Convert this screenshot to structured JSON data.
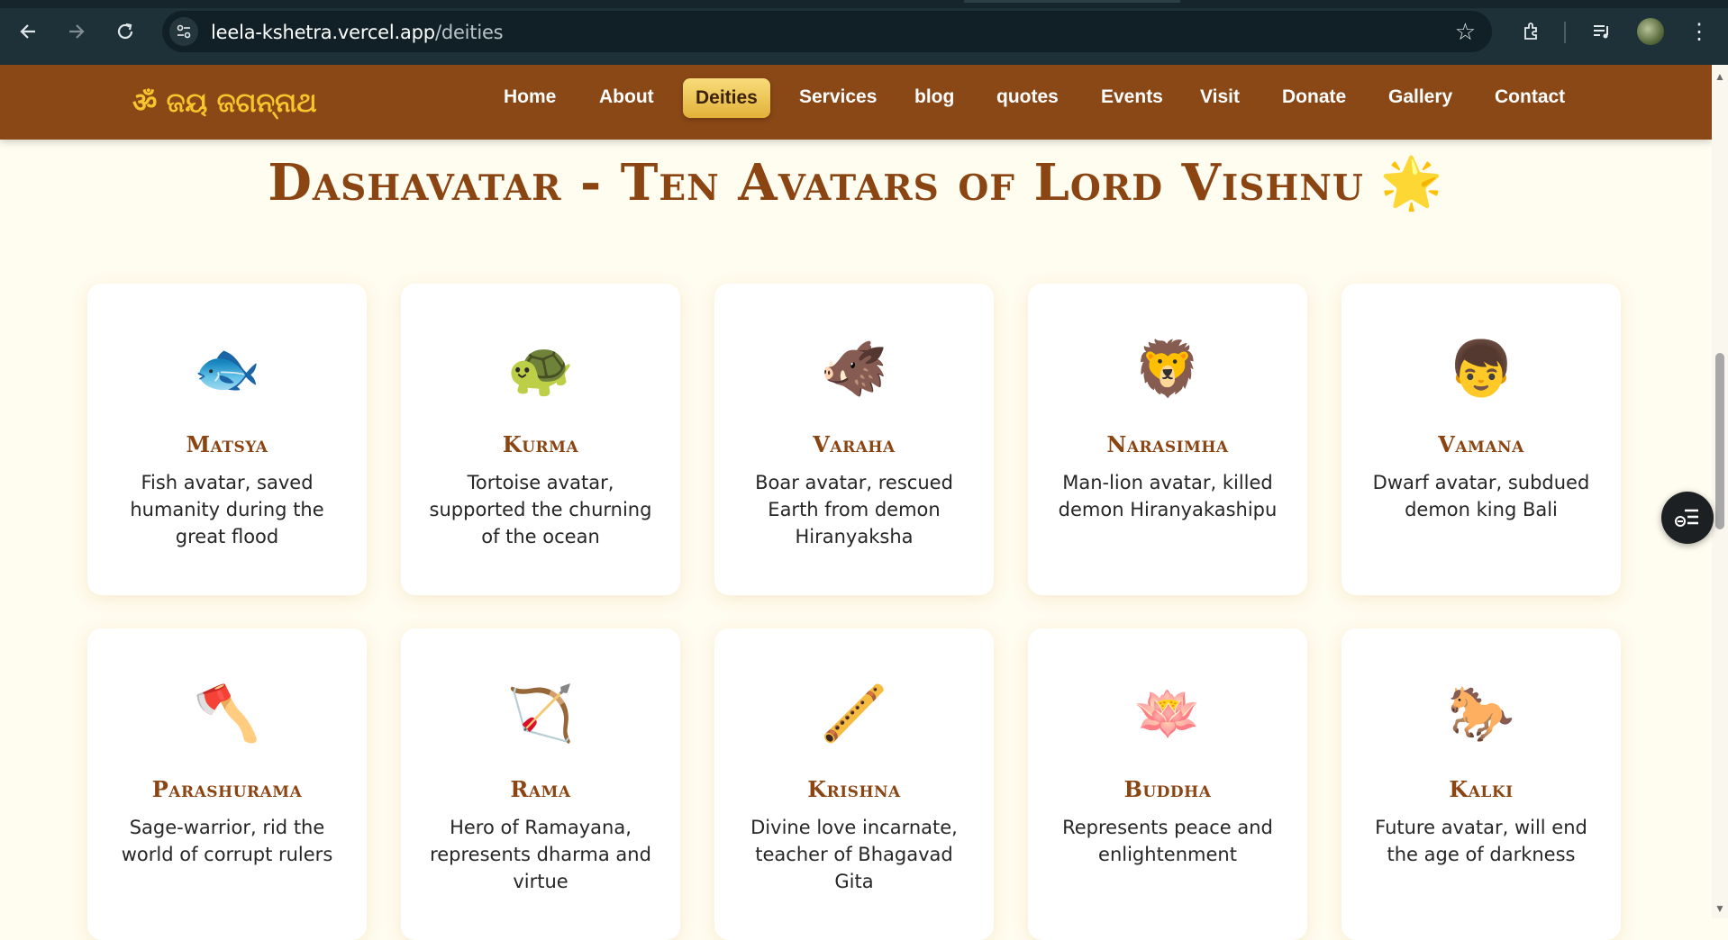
{
  "browser": {
    "url_host": "leela-kshetra.vercel.app",
    "url_path": "/deities",
    "icons": [
      "back-arrow-icon",
      "forward-arrow-icon",
      "reload-icon",
      "site-settings-icon",
      "bookmark-star-icon",
      "extensions-icon",
      "media-control-icon",
      "profile-avatar",
      "menu-dots-icon"
    ]
  },
  "site": {
    "logo": "ॐ ଜୟ ଜଗନ୍ନାଥ",
    "nav": {
      "home": "Home",
      "about": "About",
      "deities": "Deities",
      "services": "Services",
      "blog": "blog",
      "quotes": "quotes",
      "events": "Events",
      "visit": "Visit",
      "donate": "Donate",
      "gallery": "Gallery",
      "contact": "Contact"
    },
    "active_nav": "Deities"
  },
  "page": {
    "title": "Dashavatar - Ten Avatars of Lord Vishnu",
    "title_emoji": "🌟"
  },
  "avatars": [
    {
      "emoji": "🐟",
      "name": "Matsya",
      "desc": "Fish avatar, saved humanity during the great flood"
    },
    {
      "emoji": "🐢",
      "name": "Kurma",
      "desc": "Tortoise avatar, supported the churning of the ocean"
    },
    {
      "emoji": "🐗",
      "name": "Varaha",
      "desc": "Boar avatar, rescued Earth from demon Hiranyaksha"
    },
    {
      "emoji": "🦁",
      "name": "Narasimha",
      "desc": "Man-lion avatar, killed demon Hiranyakashipu"
    },
    {
      "emoji": "👦",
      "name": "Vamana",
      "desc": "Dwarf avatar, subdued demon king Bali"
    },
    {
      "emoji": "🪓",
      "name": "Parashurama",
      "desc": "Sage-warrior, rid the world of corrupt rulers"
    },
    {
      "emoji": "🏹",
      "name": "Rama",
      "desc": "Hero of Ramayana, represents dharma and virtue"
    },
    {
      "emoji": "🪈",
      "name": "Krishna",
      "desc": "Divine love incarnate, teacher of Bhagavad Gita"
    },
    {
      "emoji": "🪷",
      "name": "Buddha",
      "desc": "Represents peace and enlightenment"
    },
    {
      "emoji": "🐎",
      "name": "Kalki",
      "desc": "Future avatar, will end the age of darkness"
    }
  ],
  "colors": {
    "header_bg": "#8b4817",
    "logo": "#f7c52c",
    "heading": "#8b4513",
    "page_bg": "#fffcf0",
    "active_nav_bg": "#e8bb48"
  }
}
